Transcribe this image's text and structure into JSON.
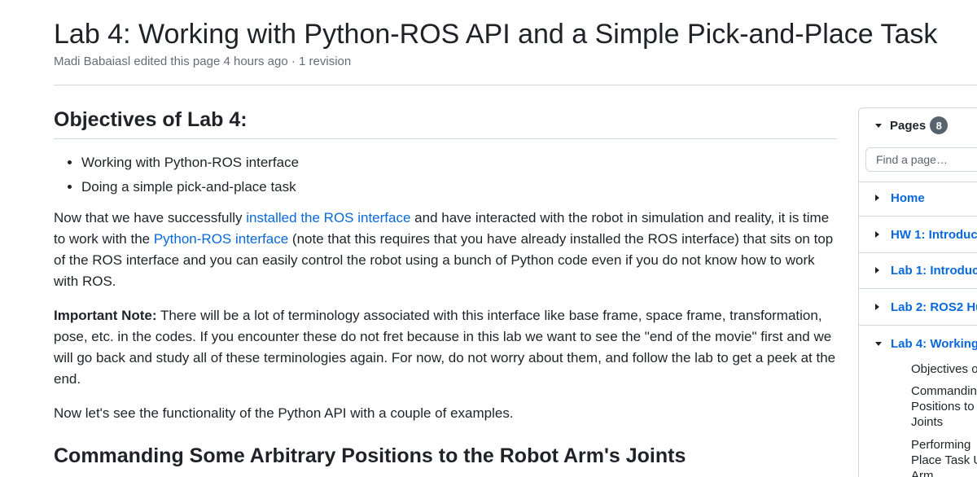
{
  "header": {
    "title": "Lab 4: Working with Python-ROS API and a Simple Pick-and-Place Task",
    "meta": "Madi Babaiasl edited this page 4 hours ago · 1 revision"
  },
  "main": {
    "objectives_heading": "Objectives of Lab 4:",
    "bullets": [
      "Working with Python-ROS interface",
      "Doing a simple pick-and-place task"
    ],
    "para1": {
      "t1": "Now that we have successfully ",
      "link1": "installed the ROS interface",
      "t2": " and have interacted with the robot in simulation and reality, it is time to work with the ",
      "link2": "Python-ROS interface",
      "t3": " (note that this requires that you have already installed the ROS interface) that sits on top of the ROS interface and you can easily control the robot using a bunch of Python code even if you do not know how to work with ROS."
    },
    "para2": {
      "bold": "Important Note:",
      "text": " There will be a lot of terminology associated with this interface like base frame, space frame, transformation, pose, etc. in the codes. If you encounter these do not fret because in this lab we want to see the \"end of the movie\" first and we will go back and study all of these terminologies again. For now, do not worry about them, and follow the lab to get a peek at the end."
    },
    "para3": "Now let's see the functionality of the Python API with a couple of examples.",
    "section_heading": "Commanding Some Arbitrary Positions to the Robot Arm's Joints"
  },
  "sidebar": {
    "pages_label": "Pages",
    "pages_count": "8",
    "search_placeholder": "Find a page…",
    "items": [
      {
        "label": "Home"
      },
      {
        "label": "HW 1: Introduc"
      },
      {
        "label": "Lab 1: Introduc"
      },
      {
        "label": "Lab 2: ROS2 Hu"
      },
      {
        "label": "Lab 4: Working"
      }
    ],
    "sub_items": [
      {
        "label": "Objectives o"
      },
      {
        "label": "Commandin\nPositions to\nJoints"
      },
      {
        "label": "Performing\nPlace Task U\nArm"
      }
    ]
  },
  "colors": {
    "link": "#0969da",
    "text": "#1f2328",
    "muted": "#656d76",
    "border": "#d0d7de",
    "badge": "#59636e"
  }
}
